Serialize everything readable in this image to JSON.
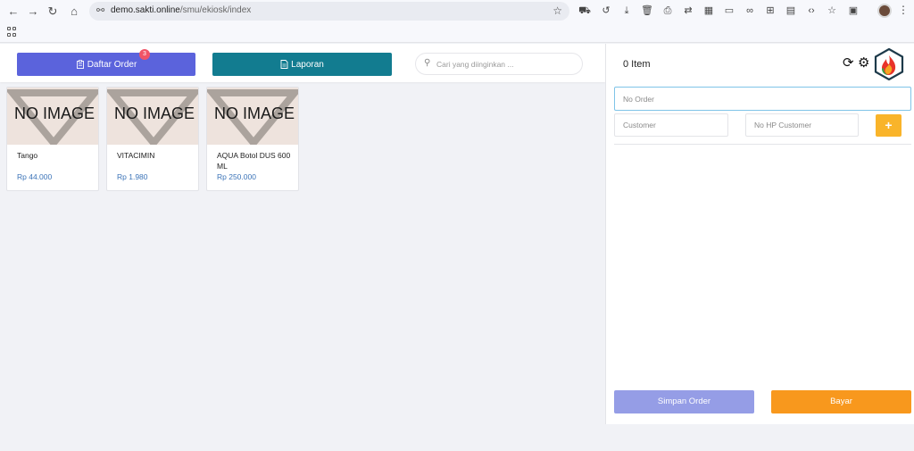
{
  "browser": {
    "url_host": "demo.sakti.online",
    "url_path": "/smu/ekiosk/index"
  },
  "toolbar": {
    "order_label": "Daftar Order",
    "order_badge": "3",
    "report_label": "Laporan",
    "search_placeholder": "Cari yang diinginkan ..."
  },
  "products": [
    {
      "placeholder": "NO IMAGE",
      "name": "Tango",
      "price": "Rp 44.000"
    },
    {
      "placeholder": "NO IMAGE",
      "name": "VITACIMIN",
      "price": "Rp 1.980"
    },
    {
      "placeholder": "NO IMAGE",
      "name": "AQUA Botol DUS 600 ML",
      "price": "Rp 250.000"
    }
  ],
  "cart": {
    "item_count": "0 Item",
    "order_placeholder": "No Order",
    "customer_placeholder": "Customer",
    "phone_placeholder": "No HP Customer",
    "add_label": "+",
    "save_label": "Simpan Order",
    "pay_label": "Bayar"
  },
  "colors": {
    "order_button": "#5b63dc",
    "report_button": "#127c90",
    "save_button": "#959de6",
    "pay_button": "#f8981d",
    "add_button": "#f9b42a",
    "price_text": "#3c74b8"
  }
}
